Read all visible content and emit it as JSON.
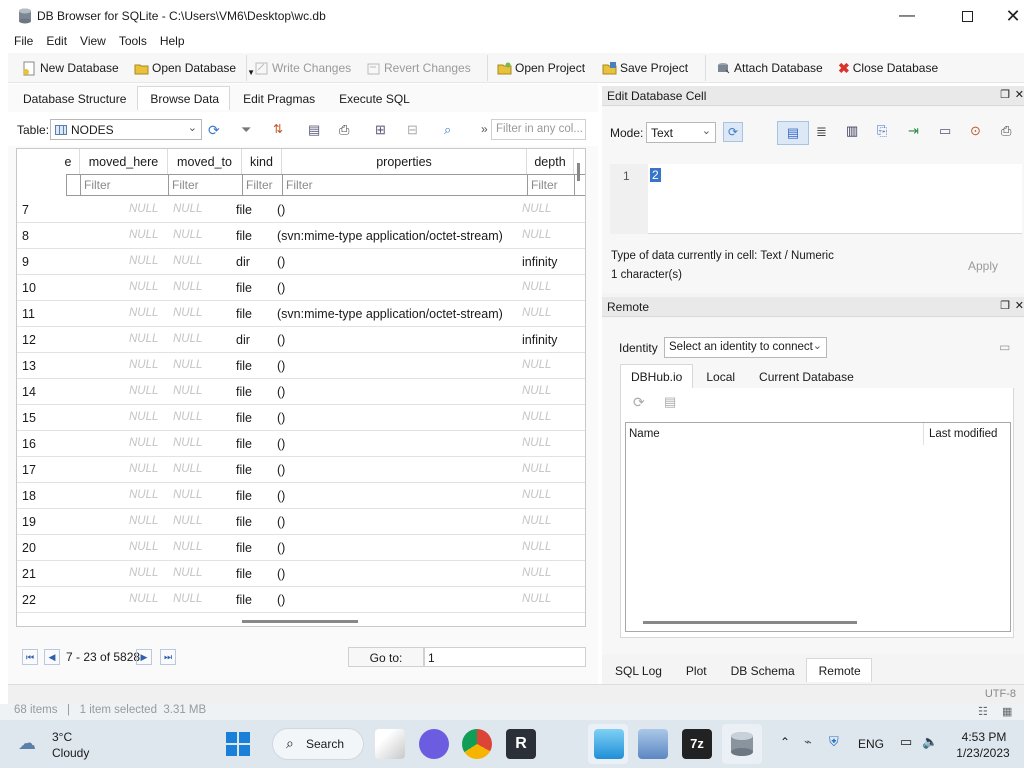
{
  "window": {
    "title": "DB Browser for SQLite - C:\\Users\\VM6\\Desktop\\wc.db"
  },
  "menu": [
    "File",
    "Edit",
    "View",
    "Tools",
    "Help"
  ],
  "toolbar": {
    "new_db": "New Database",
    "open_db": "Open Database",
    "write_changes": "Write Changes",
    "revert_changes": "Revert Changes",
    "open_project": "Open Project",
    "save_project": "Save Project",
    "attach_db": "Attach Database",
    "close_db": "Close Database"
  },
  "tabs": [
    "Database Structure",
    "Browse Data",
    "Edit Pragmas",
    "Execute SQL"
  ],
  "browse": {
    "table_label": "Table:",
    "table_value": "NODES",
    "filter_placeholder": "Filter in any col...",
    "more": "»"
  },
  "grid": {
    "columns": [
      "e",
      "moved_here",
      "moved_to",
      "kind",
      "properties",
      "depth"
    ],
    "filter_text": "Filter",
    "rows": [
      {
        "n": "7",
        "kind": "file",
        "properties": "()",
        "depth": "NULL"
      },
      {
        "n": "8",
        "kind": "file",
        "properties": "(svn:mime-type application/octet-stream)",
        "depth": "NULL"
      },
      {
        "n": "9",
        "kind": "dir",
        "properties": "()",
        "depth": "infinity"
      },
      {
        "n": "10",
        "kind": "file",
        "properties": "()",
        "depth": "NULL"
      },
      {
        "n": "11",
        "kind": "file",
        "properties": "(svn:mime-type application/octet-stream)",
        "depth": "NULL"
      },
      {
        "n": "12",
        "kind": "dir",
        "properties": "()",
        "depth": "infinity"
      },
      {
        "n": "13",
        "kind": "file",
        "properties": "()",
        "depth": "NULL"
      },
      {
        "n": "14",
        "kind": "file",
        "properties": "()",
        "depth": "NULL"
      },
      {
        "n": "15",
        "kind": "file",
        "properties": "()",
        "depth": "NULL"
      },
      {
        "n": "16",
        "kind": "file",
        "properties": "()",
        "depth": "NULL"
      },
      {
        "n": "17",
        "kind": "file",
        "properties": "()",
        "depth": "NULL"
      },
      {
        "n": "18",
        "kind": "file",
        "properties": "()",
        "depth": "NULL"
      },
      {
        "n": "19",
        "kind": "file",
        "properties": "()",
        "depth": "NULL"
      },
      {
        "n": "20",
        "kind": "file",
        "properties": "()",
        "depth": "NULL"
      },
      {
        "n": "21",
        "kind": "file",
        "properties": "()",
        "depth": "NULL"
      },
      {
        "n": "22",
        "kind": "file",
        "properties": "()",
        "depth": "NULL"
      }
    ],
    "null_text": "NULL"
  },
  "nav": {
    "range": "7 - 23 of 5828",
    "goto_label": "Go to:",
    "goto_value": "1"
  },
  "edit_cell": {
    "title": "Edit Database Cell",
    "mode_label": "Mode:",
    "mode_value": "Text",
    "line_no": "1",
    "value": "2",
    "type_info": "Type of data currently in cell: Text / Numeric",
    "char_info": "1 character(s)",
    "apply": "Apply"
  },
  "remote": {
    "title": "Remote",
    "identity_label": "Identity",
    "identity_value": "Select an identity to connect",
    "tabs": [
      "DBHub.io",
      "Local",
      "Current Database"
    ],
    "col_name": "Name",
    "col_modified": "Last modified"
  },
  "bottom_tabs": [
    "SQL Log",
    "Plot",
    "DB Schema",
    "Remote"
  ],
  "status": {
    "encoding": "UTF-8",
    "behind": "68 items   |   1 item selected  3.31 MB"
  },
  "taskbar": {
    "weather_temp": "3°C",
    "weather_desc": "Cloudy",
    "search": "Search",
    "lang": "ENG",
    "time": "4:53 PM",
    "date": "1/23/2023"
  }
}
